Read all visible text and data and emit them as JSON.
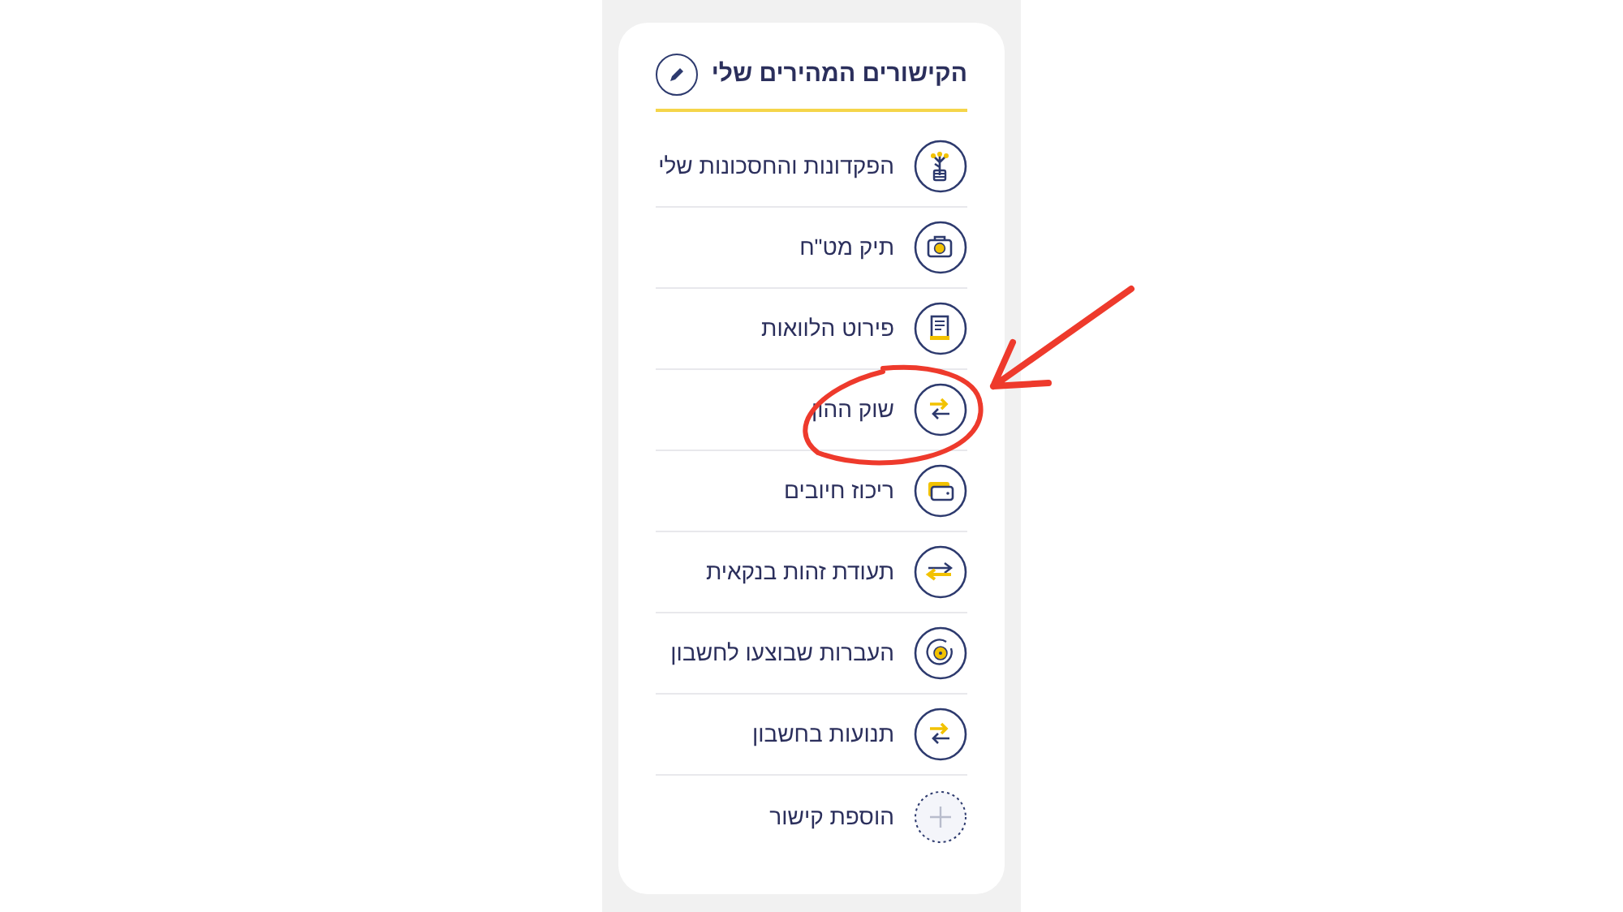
{
  "card": {
    "title": "הקישורים המהירים שלי",
    "links": [
      {
        "label": "הפקדונות והחסכונות שלי",
        "kind": "link",
        "highlighted": false
      },
      {
        "label": "תיק מט\"ח",
        "kind": "link",
        "highlighted": false
      },
      {
        "label": "פירוט הלוואות",
        "kind": "link",
        "highlighted": false
      },
      {
        "label": "שוק ההון",
        "kind": "link",
        "highlighted": true
      },
      {
        "label": "ריכוז חיובים",
        "kind": "link",
        "highlighted": false
      },
      {
        "label": "תעודת זהות בנקאית",
        "kind": "link",
        "highlighted": false
      },
      {
        "label": "העברות שבוצעו לחשבון",
        "kind": "link",
        "highlighted": false
      },
      {
        "label": "תנועות בחשבון",
        "kind": "link",
        "highlighted": false
      },
      {
        "label": "הוספת קישור",
        "kind": "add",
        "highlighted": false
      }
    ]
  }
}
